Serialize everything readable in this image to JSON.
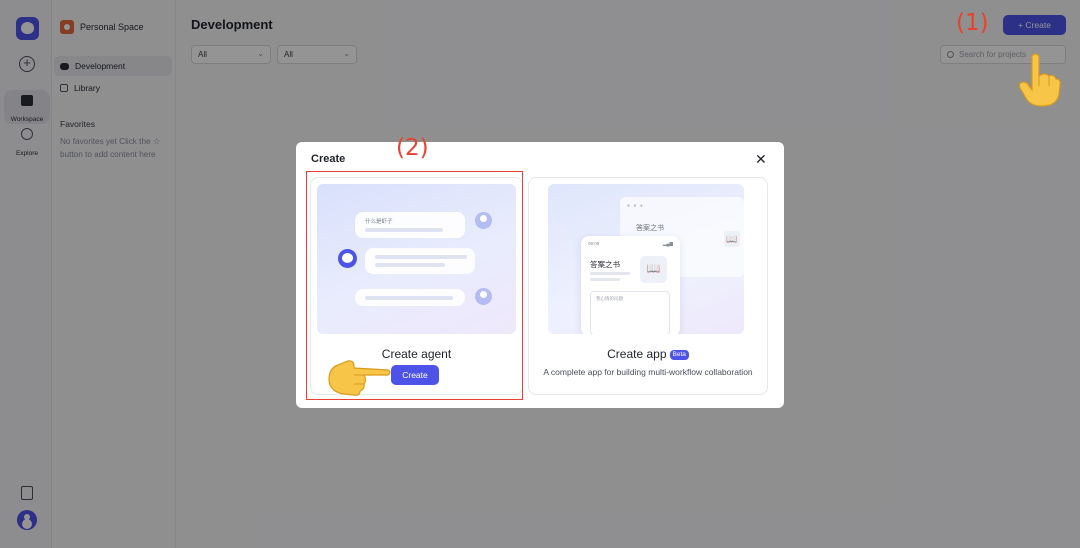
{
  "rail": {
    "workspace_label": "Workspace",
    "explore_label": "Explore"
  },
  "sidebar": {
    "space_name": "Personal Space",
    "items": [
      {
        "label": "Development"
      },
      {
        "label": "Library"
      }
    ],
    "favorites_title": "Favorites",
    "favorites_empty": "No favorites yet Click the ☆ button to add content here"
  },
  "main": {
    "title": "Development",
    "filters": [
      "All",
      "All"
    ],
    "search_placeholder": "Search for projects",
    "create_label": "+ Create"
  },
  "annotations": {
    "step1": "(1)",
    "step2": "(2)"
  },
  "modal": {
    "title": "Create",
    "agent_card": {
      "name": "Create agent",
      "button": "Create",
      "art_prompt": "什么是虾子"
    },
    "app_card": {
      "name": "Create app",
      "badge": "Beta",
      "description": "A complete app for building multi-workflow collaboration",
      "art_title": "答案之书",
      "art_time": "09:09",
      "art_input": "我心情的问题"
    }
  },
  "colors": {
    "accent": "#4d53e8",
    "annotation": "#e8412f"
  }
}
